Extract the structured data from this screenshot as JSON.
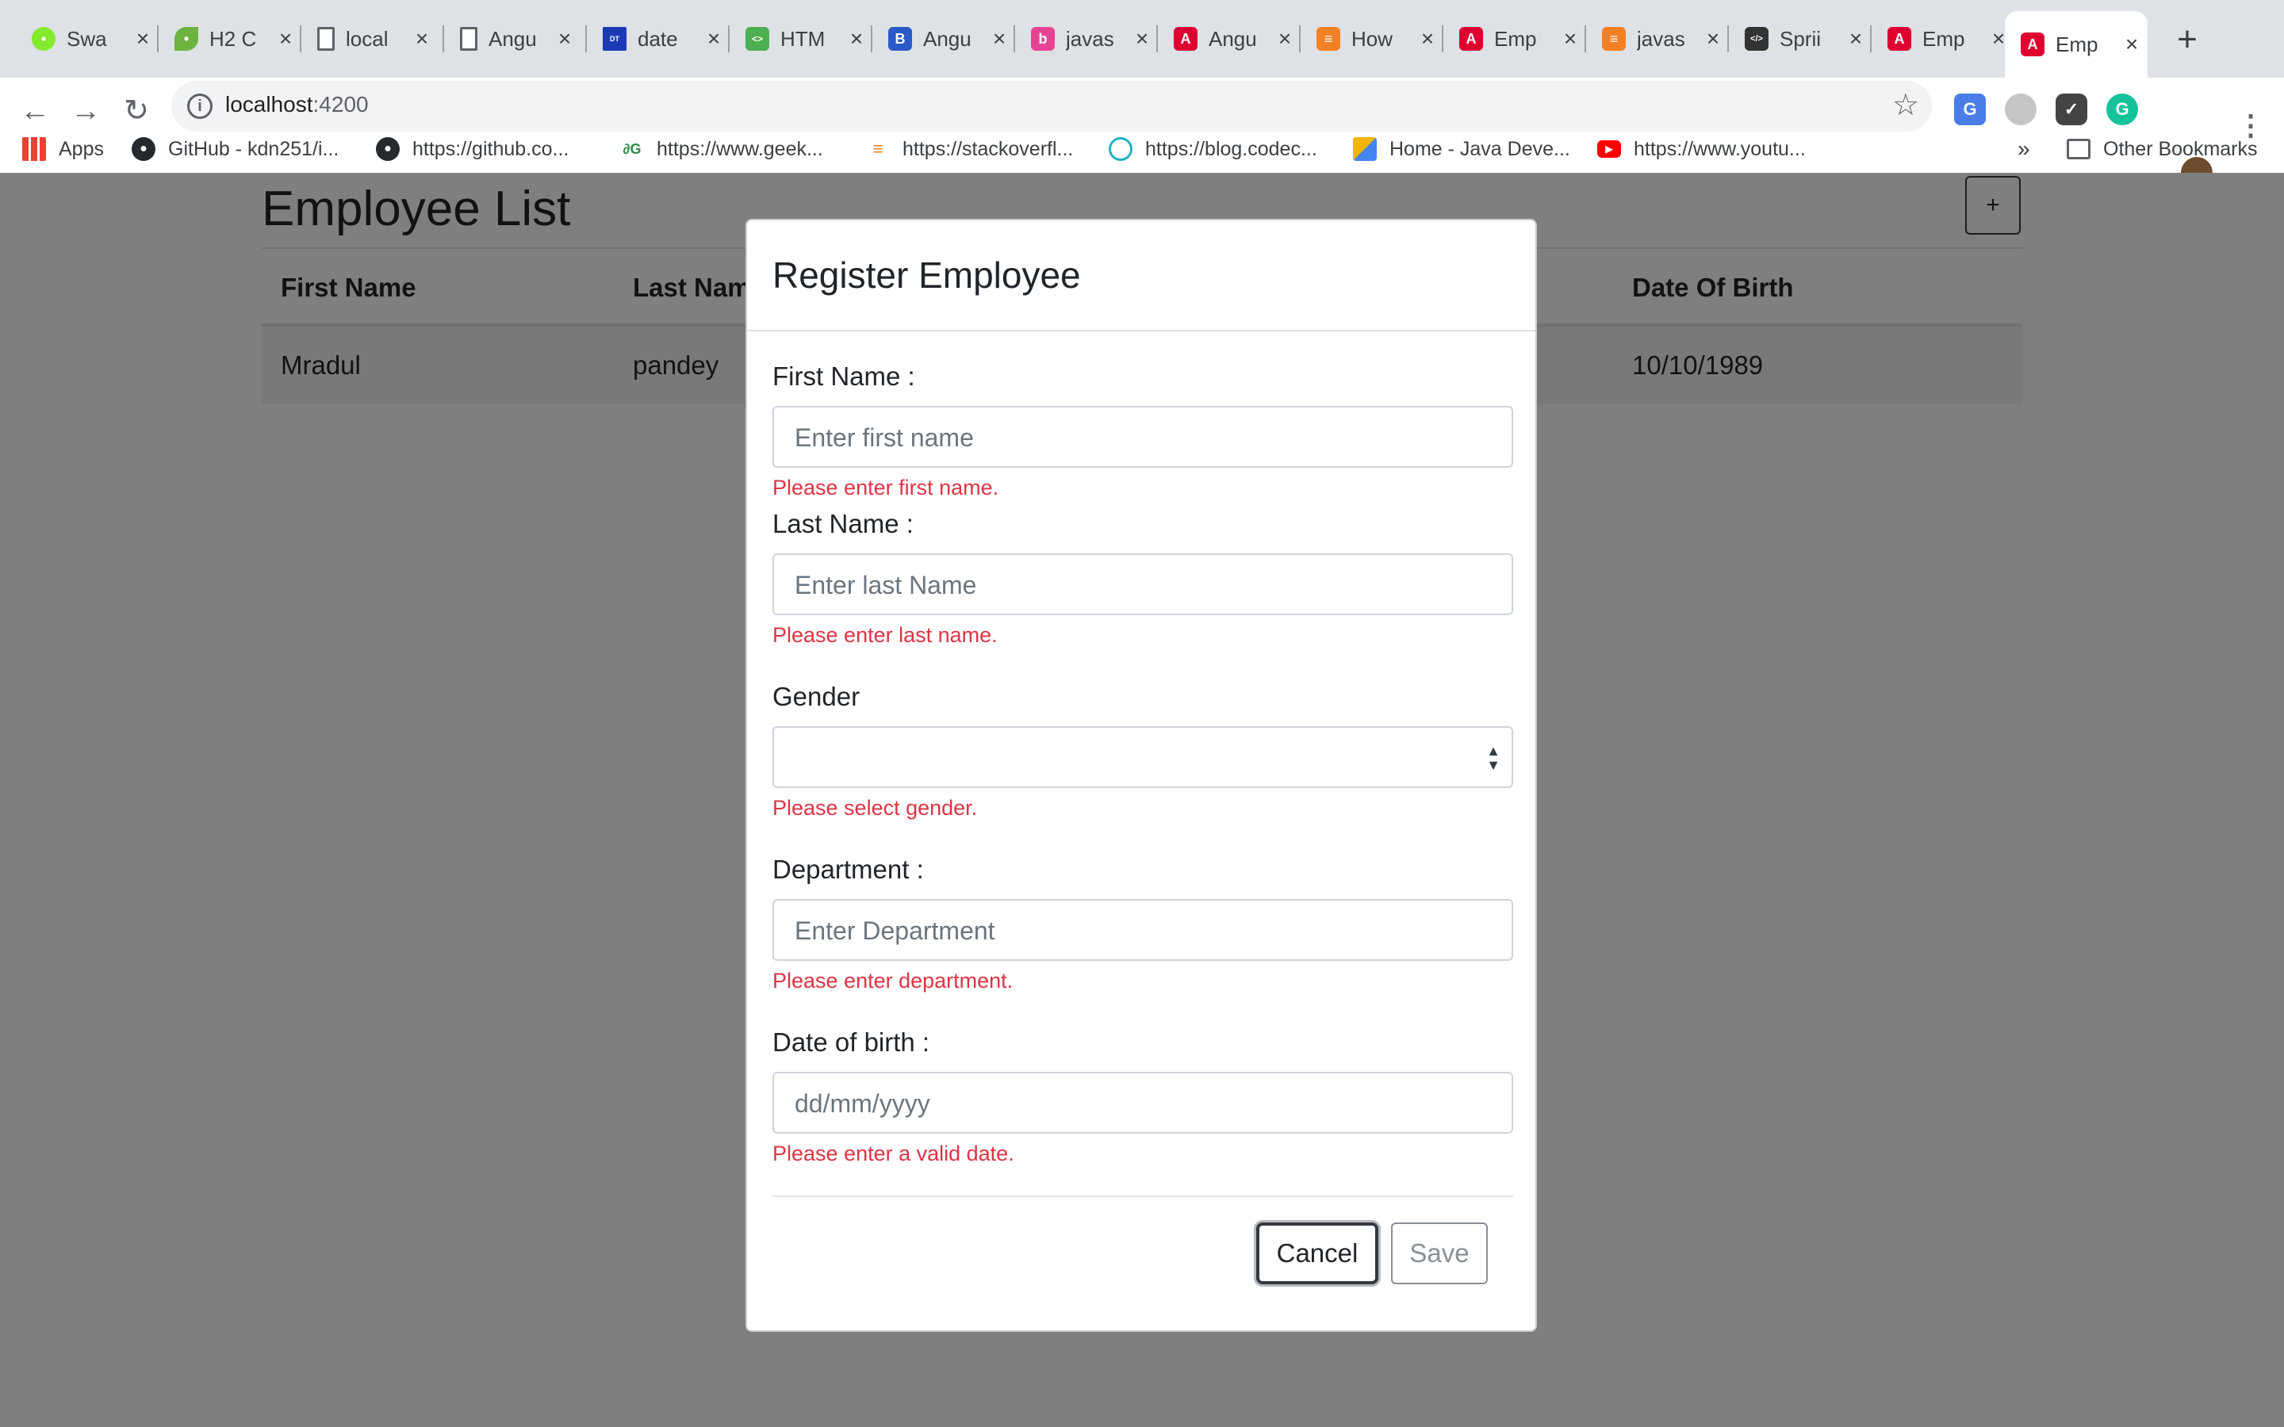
{
  "browser": {
    "tabs": [
      {
        "title": "Swa",
        "icon": "swagger-icon",
        "color": "#85ea2d"
      },
      {
        "title": "H2 C",
        "icon": "spring-leaf-icon",
        "color": "#6db33f"
      },
      {
        "title": "local",
        "icon": "page-icon",
        "color": "#ffffff"
      },
      {
        "title": "Angu",
        "icon": "page-icon",
        "color": "#ffffff"
      },
      {
        "title": "date",
        "icon": "datatables-icon",
        "color": "#1a3bb5"
      },
      {
        "title": "HTM",
        "icon": "html-icon",
        "color": "#4caf50"
      },
      {
        "title": "Angu",
        "icon": "bootstrap-icon",
        "color": "#563d7c"
      },
      {
        "title": "javas",
        "icon": "bit-icon",
        "color": "#e84393"
      },
      {
        "title": "Angu",
        "icon": "angular-icon",
        "color": "#dd0031"
      },
      {
        "title": "How",
        "icon": "stackoverflow-icon",
        "color": "#f48024"
      },
      {
        "title": "Emp",
        "icon": "angular-icon",
        "color": "#dd0031"
      },
      {
        "title": "javas",
        "icon": "stackoverflow-icon",
        "color": "#f48024"
      },
      {
        "title": "Sprii",
        "icon": "code-icon",
        "color": "#333333"
      },
      {
        "title": "Emp",
        "icon": "angular-icon",
        "color": "#dd0031"
      },
      {
        "title": "Emp",
        "icon": "angular-icon",
        "color": "#dd0031"
      }
    ],
    "url_host": "localhost",
    "url_port": ":4200",
    "bookmarks": [
      {
        "label": "Apps",
        "icon": "apps-grid-icon"
      },
      {
        "label": "GitHub - kdn251/i...",
        "icon": "github-icon"
      },
      {
        "label": "https://github.co...",
        "icon": "github-icon"
      },
      {
        "label": "https://www.geek...",
        "icon": "geeksforgeeks-icon"
      },
      {
        "label": "https://stackoverfl...",
        "icon": "stackoverflow-icon"
      },
      {
        "label": "https://blog.codec...",
        "icon": "codecentric-icon"
      },
      {
        "label": "Home - Java Deve...",
        "icon": "java-dev-icon"
      },
      {
        "label": "https://www.youtu...",
        "icon": "youtube-icon"
      }
    ],
    "bookmarks_overflow": "»",
    "other_bookmarks": "Other Bookmarks"
  },
  "page": {
    "title": "Employee List",
    "add_label": "+",
    "table": {
      "headers": [
        "First Name",
        "Last Nam",
        "Date Of Birth"
      ],
      "rows": [
        [
          "Mradul",
          "pandey",
          "10/10/1989"
        ]
      ]
    }
  },
  "modal": {
    "title": "Register Employee",
    "fields": [
      {
        "label": "First Name :",
        "placeholder": "Enter first name",
        "error": "Please enter first name."
      },
      {
        "label": "Last Name :",
        "placeholder": "Enter last Name",
        "error": "Please enter last name."
      },
      {
        "label": "Gender",
        "placeholder": "",
        "error": "Please select gender."
      },
      {
        "label": "Department :",
        "placeholder": "Enter Department",
        "error": "Please enter department."
      },
      {
        "label": "Date of birth :",
        "placeholder": "dd/mm/yyyy",
        "error": "Please enter a valid date."
      }
    ],
    "cancel_label": "Cancel",
    "save_label": "Save"
  }
}
